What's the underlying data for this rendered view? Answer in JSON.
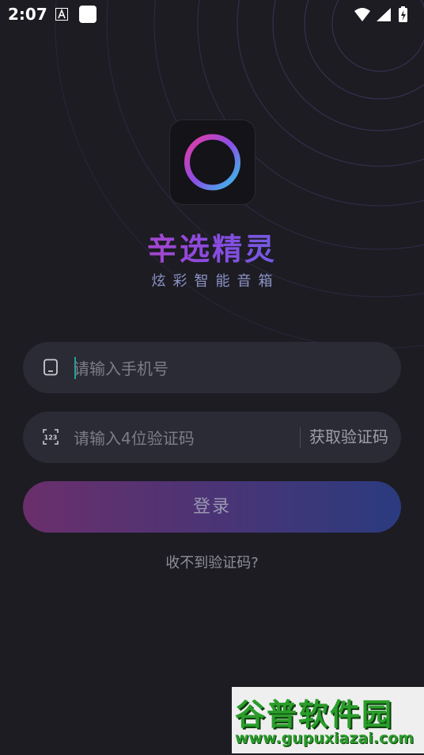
{
  "status_bar": {
    "time": "2:07",
    "icons": [
      "text-a-icon",
      "app-square-icon",
      "wifi-icon",
      "signal-icon",
      "battery-charging-icon"
    ]
  },
  "brand": {
    "title": "辛选精灵",
    "subtitle": "炫彩智能音箱",
    "icon": "ring-logo-icon",
    "gradient_colors": [
      "#e23aa0",
      "#8a4be0",
      "#3f7fe8"
    ]
  },
  "phone_field": {
    "icon": "phone-icon",
    "placeholder": "请输入手机号",
    "value": ""
  },
  "code_field": {
    "icon": "number-123-icon",
    "placeholder": "请输入4位验证码",
    "value": "",
    "get_code_label": "获取验证码"
  },
  "login_button": {
    "label": "登录",
    "gradient_colors": [
      "#6a2f6b",
      "#2b3b7f"
    ]
  },
  "no_code_link": "收不到验证码?",
  "watermark": {
    "title": "谷普软件园",
    "url": "www.gupuxiazai.com"
  },
  "colors": {
    "background": "#1c1c22",
    "field_background": "#2a2b35",
    "caret": "#1ca39b"
  }
}
